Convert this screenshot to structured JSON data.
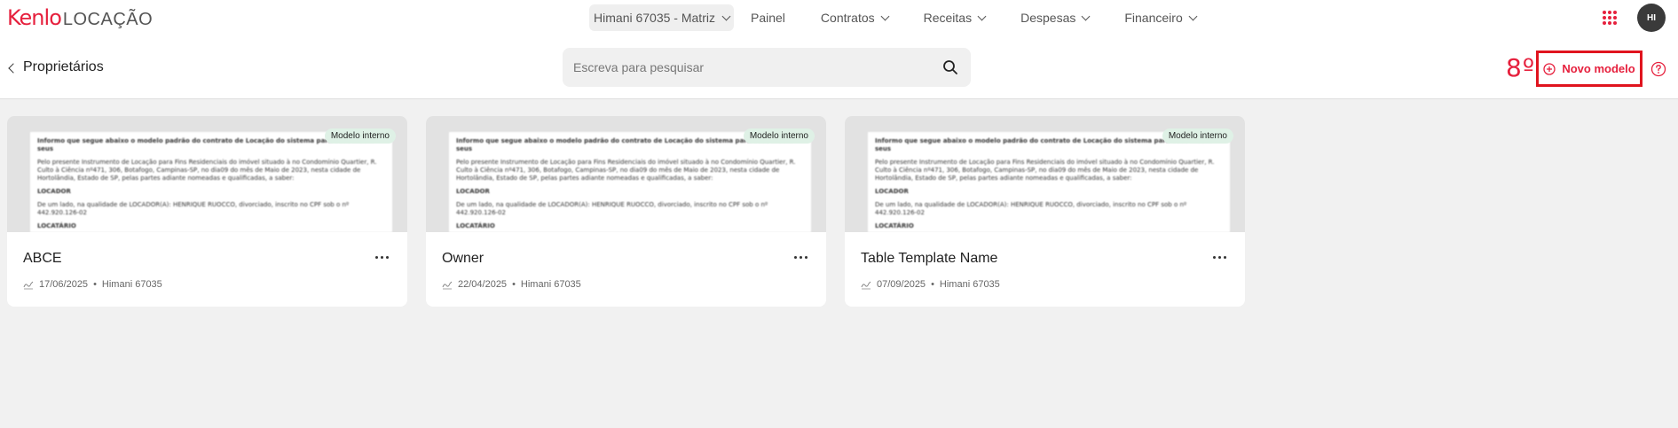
{
  "header": {
    "logo_brand": "Kenlo",
    "logo_product": "LOCAÇÃO",
    "org_selector": "Himani 67035 - Matriz",
    "nav": [
      {
        "label": "Painel",
        "has_dropdown": false
      },
      {
        "label": "Contratos",
        "has_dropdown": true
      },
      {
        "label": "Receitas",
        "has_dropdown": true
      },
      {
        "label": "Despesas",
        "has_dropdown": true
      },
      {
        "label": "Financeiro",
        "has_dropdown": true
      }
    ],
    "avatar_initials": "HI"
  },
  "page": {
    "title": "Proprietários",
    "search_placeholder": "Escreva para pesquisar",
    "counter": "8º",
    "new_button_label": "Novo modelo"
  },
  "cards": [
    {
      "title": "ABCE",
      "date": "17/06/2025",
      "author": "Himani 67035",
      "badge": "Modelo interno",
      "preview": {
        "heading": "Informo que segue abaixo o modelo padrão do contrato de Locação do sistema para você inserir seus",
        "body": "Pelo presente Instrumento de Locação para Fins Residenciais do imóvel situado à no Condomínio Quartier, R. Culto à Ciência nº471, 306, Botafogo, Campinas-SP, no dia09 do mês de Maio de 2023, nesta cidade de Hortolândia, Estado de SP, pelas partes adiante nomeadas e qualificadas, a saber:",
        "section1": "LOCADOR",
        "line": "De um lado, na qualidade de LOCADOR(A): HENRIQUE RUOCCO, divorciado, inscrito no CPF sob o nº 442.920.126-02",
        "section2": "LOCATÁRIO"
      }
    },
    {
      "title": "Owner",
      "date": "22/04/2025",
      "author": "Himani 67035",
      "badge": "Modelo interno",
      "preview": {
        "heading": "Informo que segue abaixo o modelo padrão do contrato de Locação do sistema para você inserir seus",
        "body": "Pelo presente Instrumento de Locação para Fins Residenciais do imóvel situado à no Condomínio Quartier, R. Culto à Ciência nº471, 306, Botafogo, Campinas-SP, no dia09 do mês de Maio de 2023, nesta cidade de Hortolândia, Estado de SP, pelas partes adiante nomeadas e qualificadas, a saber:",
        "section1": "LOCADOR",
        "line": "De um lado, na qualidade de LOCADOR(A): HENRIQUE RUOCCO, divorciado, inscrito no CPF sob o nº 442.920.126-02",
        "section2": "LOCATÁRIO"
      }
    },
    {
      "title": "Table Template Name",
      "date": "07/09/2025",
      "author": "Himani 67035",
      "badge": "Modelo interno",
      "preview": {
        "heading": "Informo que segue abaixo o modelo padrão do contrato de Locação do sistema para você inserir seus",
        "body": "Pelo presente Instrumento de Locação para Fins Residenciais do imóvel situado à no Condomínio Quartier, R. Culto à Ciência nº471, 306, Botafogo, Campinas-SP, no dia09 do mês de Maio de 2023, nesta cidade de Hortolândia, Estado de SP, pelas partes adiante nomeadas e qualificadas, a saber:",
        "section1": "LOCADOR",
        "line": "De um lado, na qualidade de LOCADOR(A): HENRIQUE RUOCCO, divorciado, inscrito no CPF sob o nº 442.920.126-02",
        "section2": "LOCATÁRIO"
      }
    }
  ],
  "colors": {
    "accent": "#e6203d",
    "highlight_border": "#e0141e",
    "badge_bg": "#dff1e6"
  }
}
